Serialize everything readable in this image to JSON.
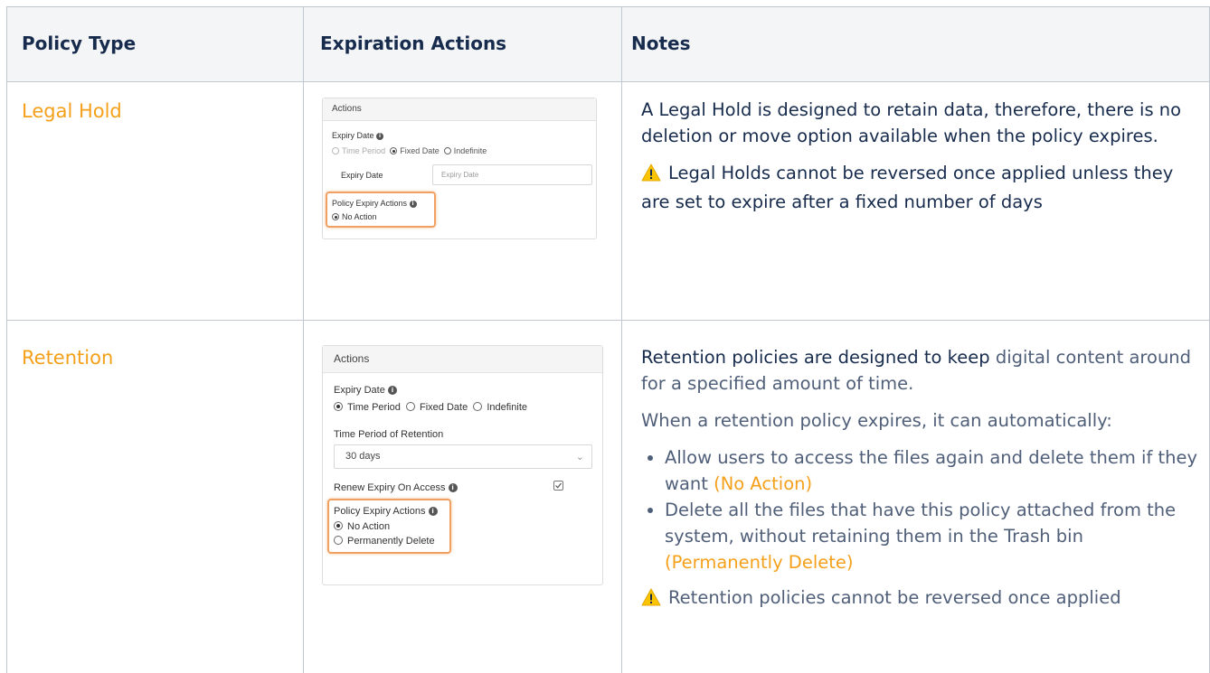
{
  "headers": {
    "policy_type": "Policy Type",
    "expiration_actions": "Expiration Actions",
    "notes": "Notes"
  },
  "rows": [
    {
      "policy_type": "Legal Hold",
      "form": {
        "title": "Actions",
        "expiry_date_label": "Expiry Date",
        "options": [
          "Time Period",
          "Fixed Date",
          "Indefinite"
        ],
        "selected_option": "Fixed Date",
        "field_label": "Expiry Date",
        "field_placeholder": "Expiry Date",
        "actions_label": "Policy Expiry Actions",
        "actions": [
          "No Action"
        ],
        "selected_action": "No Action"
      },
      "notes": {
        "paragraph": "A Legal Hold is designed to retain data, therefore, there is no deletion or move option available when the policy expires.",
        "warning": "Legal Holds cannot be reversed once applied unless they are set to expire after a fixed number of days"
      }
    },
    {
      "policy_type": "Retention",
      "form": {
        "title": "Actions",
        "expiry_date_label": "Expiry Date",
        "options": [
          "Time Period",
          "Fixed Date",
          "Indefinite"
        ],
        "selected_option": "Time Period",
        "period_label": "Time Period of Retention",
        "period_value": "30 days",
        "renew_label": "Renew Expiry On Access",
        "renew_checked": true,
        "actions_label": "Policy Expiry Actions",
        "actions": [
          "No Action",
          "Permanently Delete"
        ],
        "selected_action": "No Action"
      },
      "notes": {
        "p1_a": "Retention policies are designed to keep ",
        "p1_b": "digital content around for a specified amount of time.",
        "p2": "When a retention policy expires, it can automatically:",
        "bullets": [
          {
            "text": "Allow users to access the files again and delete them if they want ",
            "tag": "(No Action)"
          },
          {
            "text": "Delete all the files that have this policy attached from the system, without retaining them in the Trash bin ",
            "tag": "(Permanently Delete)"
          }
        ],
        "warning": "Retention policies cannot be reversed once applied"
      }
    }
  ],
  "colors": {
    "link_orange": "#f5a01a",
    "header_bg": "#f4f5f7",
    "border": "#c1c7d0",
    "highlight": "#f0a060",
    "warning": "#ffc400"
  },
  "icons": [
    "warning-icon",
    "info-icon",
    "chevron-down-icon",
    "checkbox-icon"
  ]
}
